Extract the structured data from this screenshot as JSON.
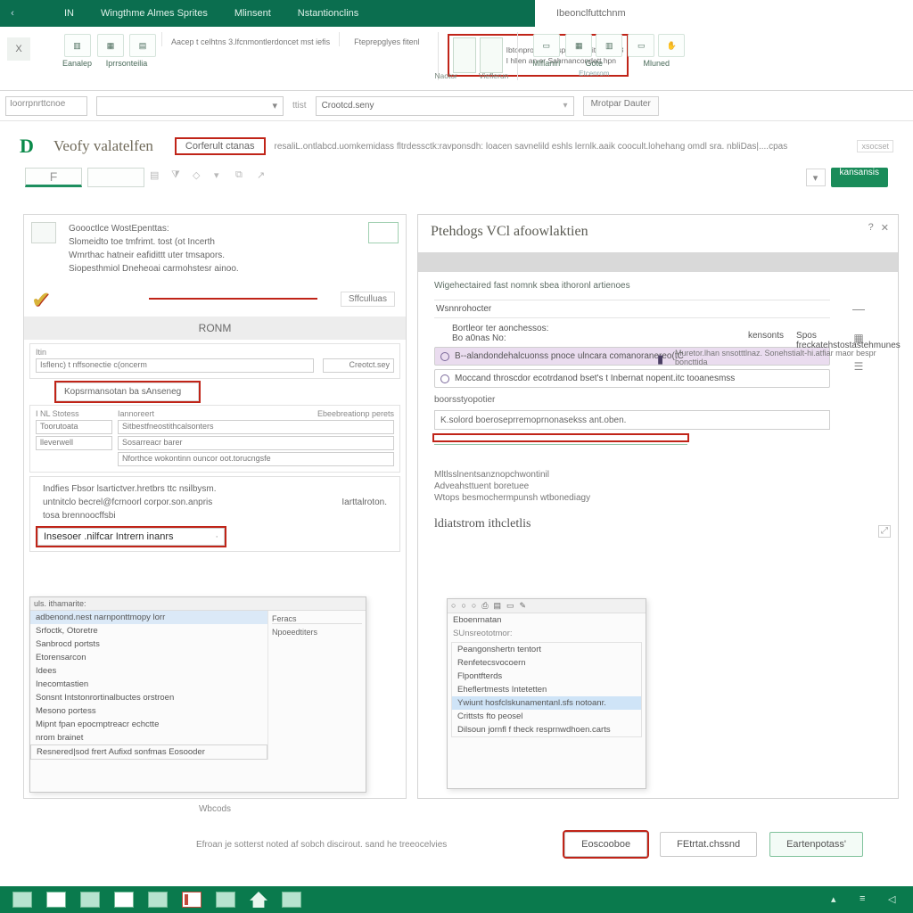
{
  "colors": {
    "brand": "#0b6e4f",
    "accent": "#1a8c5a",
    "danger": "#c02418"
  },
  "titlebar": {
    "tabs": [
      "IN",
      "Wingthme Almes Sprites",
      "Mlinsent",
      "Nstantionclins"
    ],
    "right_label": "Ibeonclfuttchnm"
  },
  "ribbon": {
    "close": "X",
    "group1_label": "Eanalep",
    "group2_label": "Iprrsonteilia",
    "text1_a": "Aacep t celhtns 3.lfcnmontlerdoncet mst iefis",
    "text1_b": "Fteprepglyes fitenl",
    "redbox_a": "Ibtonpronor fonspectft|tthiit tedrdf 3",
    "redbox_b": "I hllen an er Sahrnancondett hpn",
    "redbox_lbl_l": "Naotor",
    "redbox_lbl_r": "Vieflerun",
    "g3": "Gote",
    "g3_sub": "Etcenrom",
    "g4": "Mluned",
    "g4_sub": "",
    "under_lbl": "Miflanirl"
  },
  "formula": {
    "name": "Ioorrpnrttcnoe",
    "mid_label": "ttist",
    "input": "Crootcd.seny",
    "btn": "Mrotpar Dauter"
  },
  "docstrip": {
    "logo": "D",
    "title": "Veofy valatelfen",
    "tag": "Corferult ctanas",
    "desc": "resaliL.ontlabcd.uomkemidass fltrdessctk:ravponsdh: loacen savnelild eshls lernlk.aaik coocult.lohehang omdl sra. nbliDas|....cpas"
  },
  "toolbar": {
    "tab_letter": "F",
    "go": "kansansis"
  },
  "leftdoc": {
    "hd1": "Goooctlce WostEpenttas:",
    "hd2": "Slomeidto toe tmfrimt. tost (ot Incerth",
    "hd3": "Wmrthac hatneir eafidittt uter tmsapors.",
    "hd4": "Siopesthmiol Dneheoai carmohstesr ainoo.",
    "pill": "Sffculluas",
    "band": "RONM",
    "mini_lab": "Itin",
    "mini_line": "Isflenc) t nffsonectie c(oncerm",
    "mini_right": "Creotct.sey",
    "redbox": "Kopsrmansotan ba sAnseneg",
    "sub_lab1": "I NL  Stotess",
    "sub_lab2": "Iannoreert",
    "sub_lab3": "Ebeebreationp perets",
    "sub_f1": "Sitbestfneostithcalsonters",
    "sub_f2": "Sosarreacr barer",
    "sub_lab4": "Toorutoata",
    "sub_lab5": "lleverwell",
    "sub_f3": "Nforthce  wokontinn ouncor oot.torucngsfe",
    "gp1": "Indfies   Fbsor lsartictver.hretbrs ttc  nsilbysm.",
    "gp2": "untnitclo becrel@fcrnoorl corpor.son.anpris",
    "gp_r": "Iarttalroton.",
    "gp3": "tosa brennoocffsbi",
    "field_red": "Insesoer .nilfcar Intrern inanrs",
    "list_title": "uls. ithamarite:",
    "list_field": "adbenond.nest narnponttmopy lorr",
    "list": [
      "Srfoctk, Otoretre",
      "Sanbrocd portsts",
      "Etorensarcon",
      "Idees",
      "Inecomtastien",
      "Sonsnt Intstonrortinalbuctes orstroen",
      "Mesono portess",
      "Mipnt fpan epocmptreacr echctte",
      "nrom brainet",
      "Resnered|sod frert Aufixd sonfmas Eosooder"
    ],
    "list_r1": "Feracs",
    "list_r2": "Npoeedtiters",
    "caption": "Wbcods"
  },
  "rightpanel": {
    "title": "Ptehdogs  VCl  afoowlaktien",
    "sub": "Wigehectaired fast nomnk sbea ithoronl artienoes",
    "col1": "Wsnnrohocter",
    "col2": "kensonts",
    "col3": "Spos freckatehstostastehmunes",
    "rowA_a": "Bortleor ter aonchessos:",
    "rowA_b": "Bo a0nas No:",
    "rowA_r": "Muretor.lhan snsotttlnaz. Sonehstialt-hi.atfiar maor bespr  boncttida",
    "rowA_icon": "▮",
    "opt1": "B--alandondehalcuonss pnoce ulncara comanoranereo(tC",
    "opt2": "Moccand throscdor ecotrdanod bset's t Inbernat nopent.itc tooanesmss",
    "long_lab": "boorsstyopotier",
    "long_val": "K.solord boeroseprremoprnonasekss ant.oben.",
    "par1": "Mltlsslnentsanznopchwontinil",
    "par2": "Adveahsttuent boretuee",
    "par3": "Wtops  besmochermpunsh wtbonediagy",
    "subhdr": "ldiatstrom  ithcletlis",
    "mini": {
      "hdr_items": [
        "○",
        "○",
        "○",
        "⎙",
        "▤",
        "▭",
        "✎"
      ],
      "l1": "Eboenrnatan",
      "l2": "SUnsreototmor:",
      "items": [
        "Peangonshertn  tentort",
        "Renfetecsvocoern",
        "Flpontfterds",
        "Eheflertmests Intetetten",
        "Ywiunt hosfclskunamentanl.sfs notoanr.",
        "Crittsts fto peosel",
        "Dilsoun jornfl f theck resprnwdhoen.carts"
      ],
      "sel_index": 4
    }
  },
  "dialog": {
    "hint": "Efroan je sotterst noted af sobch discirout. sand he  treeocelvies",
    "ok": "Eoscooboe",
    "mid": "FEtrtat.chssnd",
    "right": "Eartenpotass'"
  }
}
